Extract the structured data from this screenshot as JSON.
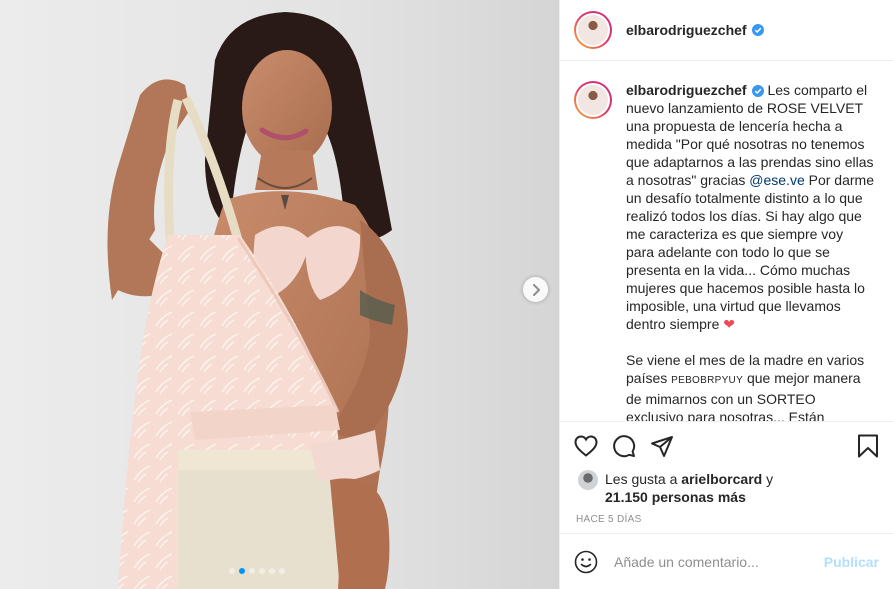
{
  "post": {
    "username": "elbarodriguezchef",
    "verified": true,
    "carousel": {
      "slide_count": 6,
      "active_index": 1
    },
    "caption": {
      "part1": "Les comparto el nuevo lanzamiento de ROSE VELVET una propuesta de lencería hecha a medida \"Por qué nosotras no tenemos que adaptarnos a las prendas sino ellas a nosotras\" gracias ",
      "mention": "@ese.ve",
      "part2": " Por darme un desafío totalmente distinto a lo que realizó todos los días. Si hay algo que me caracteriza es que siempre voy para adelante con todo lo que se presenta en la vida... Cómo muchas mujeres que hacemos posible hasta lo imposible, una virtud que llevamos dentro siempre ",
      "emoji": "❤",
      "part3": "Se viene el mes de la madre en varios países ",
      "flags": "PEBOBRPYUY",
      "part4": " que mejor manera de mimarnos con un SORTEO exclusivo para nosotras... Están atentas"
    },
    "likes": {
      "prefix": "Les gusta a ",
      "first_user": "arielborcard",
      "connector": " y",
      "count_text": "21.150 personas más"
    },
    "timestamp": "HACE 5 DÍAS",
    "comment": {
      "placeholder": "Añade un comentario...",
      "publish_label": "Publicar"
    }
  },
  "icons": {
    "like": "heart-icon",
    "comment": "comment-icon",
    "share": "share-icon",
    "save": "bookmark-icon",
    "emoji": "emoji-icon",
    "next": "chevron-right-icon",
    "verified": "verified-badge-icon"
  },
  "colors": {
    "accent": "#0095f6",
    "verified": "#3897f0",
    "mention": "#00376b",
    "heart": "#ed4956",
    "publish_disabled": "#b2dffc",
    "muted": "#8e8e8e"
  }
}
